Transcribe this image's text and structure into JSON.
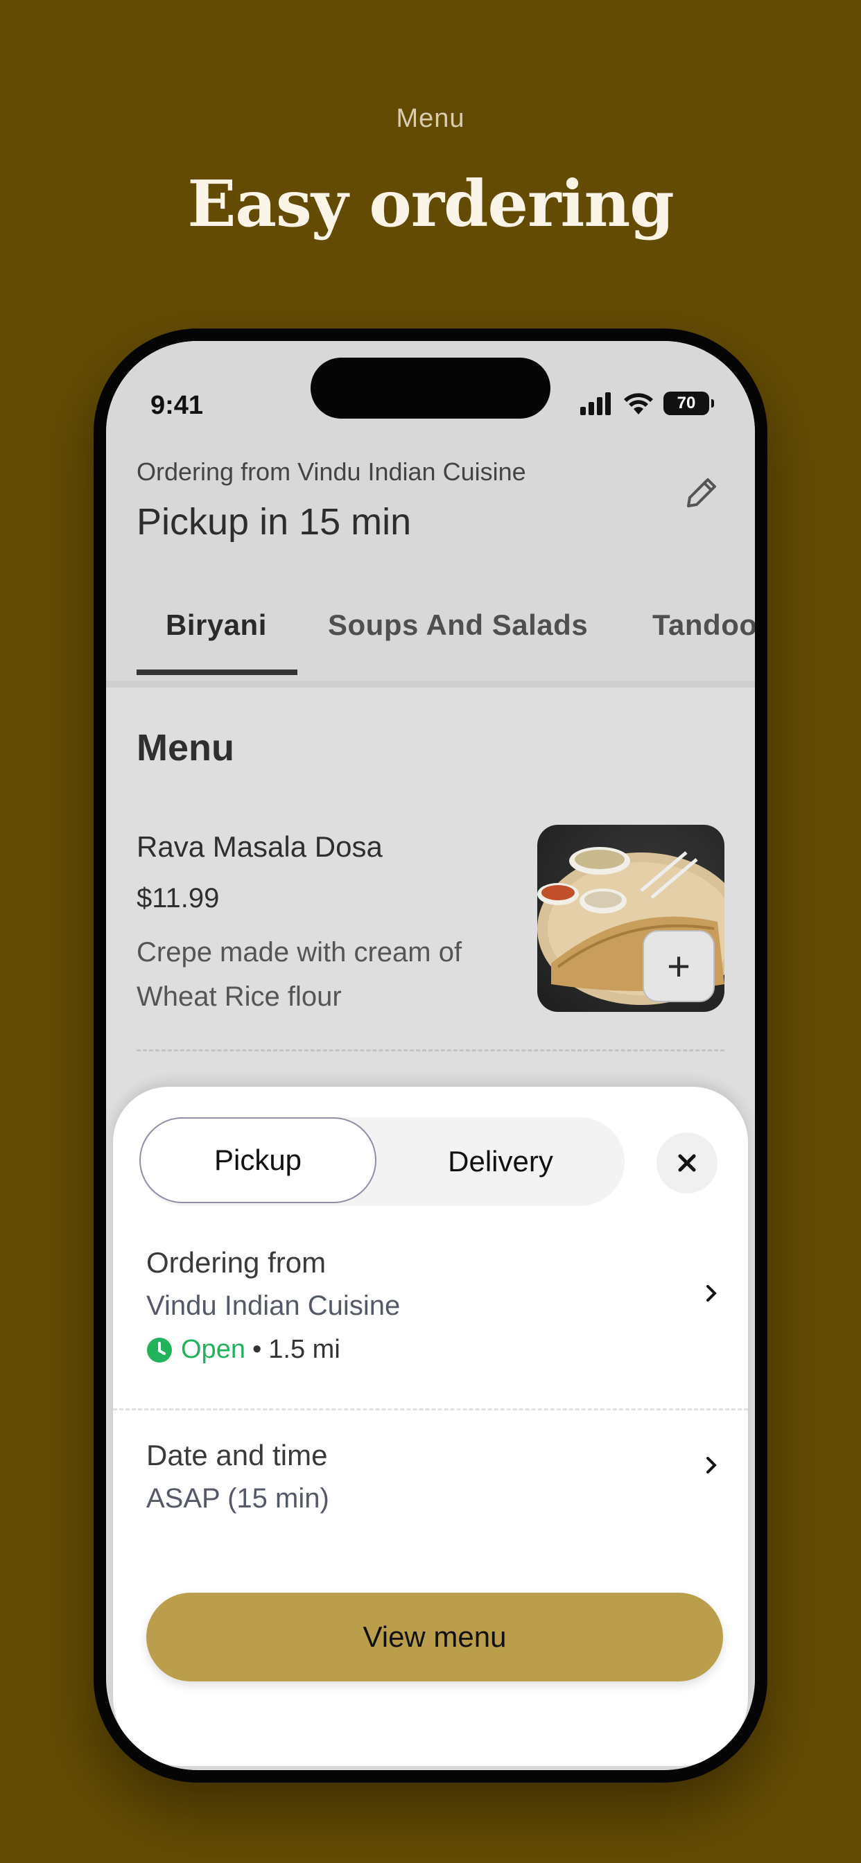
{
  "page": {
    "eyebrow": "Menu",
    "headline": "Easy ordering",
    "background_color": "#634b04"
  },
  "status_bar": {
    "time": "9:41",
    "battery": "70",
    "icons": [
      "signal-icon",
      "wifi-icon",
      "battery-icon"
    ]
  },
  "header": {
    "ordering_from": "Ordering from Vindu Indian Cuisine",
    "pickup_title": "Pickup in 15 min",
    "edit_icon": "pencil-icon"
  },
  "tabs": [
    {
      "label": "Biryani",
      "active": true
    },
    {
      "label": "Soups And Salads",
      "active": false
    },
    {
      "label": "Tandoo",
      "active": false
    }
  ],
  "menu": {
    "title": "Menu",
    "items": [
      {
        "name": "Rava Masala Dosa",
        "price": "$11.99",
        "description": "Crepe made with cream of Wheat Rice flour",
        "add_icon": "plus-icon"
      }
    ]
  },
  "sheet": {
    "segment": {
      "active": "Pickup",
      "inactive": "Delivery"
    },
    "close_icon": "close-icon",
    "ordering_from_label": "Ordering from",
    "restaurant": "Vindu Indian Cuisine",
    "status": "Open",
    "separator": "•",
    "distance": "1.5 mi",
    "date_time_label": "Date and time",
    "date_time_value": "ASAP (15 min)",
    "cta": "View menu",
    "accent_color": "#bb9e4b",
    "open_color": "#22b25b"
  }
}
